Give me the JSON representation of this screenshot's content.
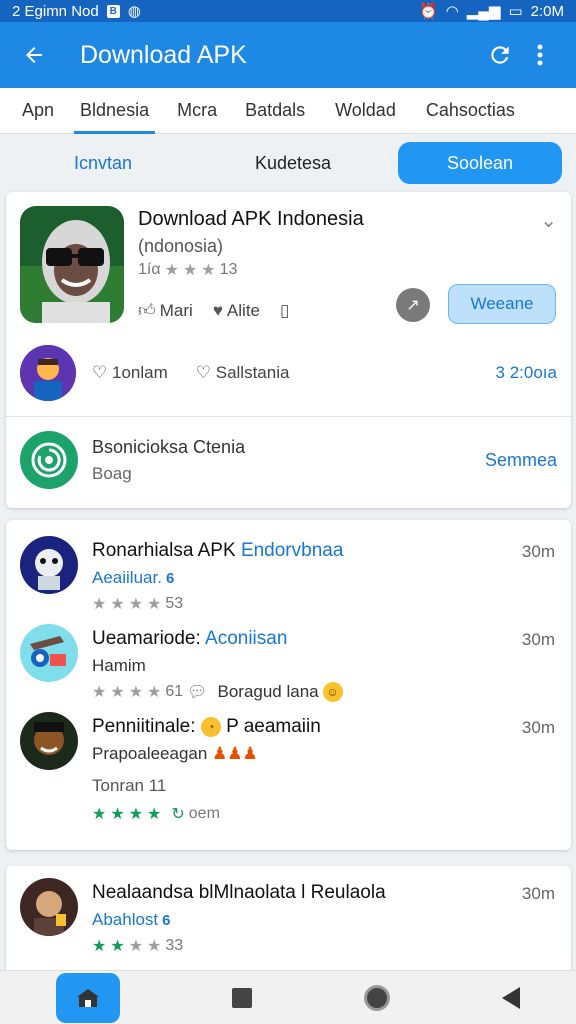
{
  "status_bar": {
    "time_left": "2 Egimn Nod",
    "time_right": "2:0M"
  },
  "appbar": {
    "title": "Download APK"
  },
  "tabs": [
    {
      "label": "Apn"
    },
    {
      "label": "Bldnesia"
    },
    {
      "label": "Mcra"
    },
    {
      "label": "Batdals"
    },
    {
      "label": "Woldad"
    },
    {
      "label": "Cahsoctias"
    }
  ],
  "segments": {
    "left": "Icnvtan",
    "center": "Kudetesa",
    "right": "Soolean"
  },
  "app_card": {
    "title": "Download APK Indonesia",
    "subtitle": "(ndonosia)",
    "rating_prefix": "1íα",
    "rating_suffix": "13",
    "actions": {
      "a1": "Mari",
      "a2": "Alite"
    },
    "primary_button": "Weeane",
    "row2": {
      "m1": "1onlam",
      "m2": "Sallstania",
      "right": "3 2:0oıa"
    },
    "row3": {
      "title": "Bsonicioksa Ctenia",
      "sub": "Boag",
      "right": "Semmea"
    }
  },
  "reviews": [
    {
      "name": "Ronarhialsa APK",
      "name_accent": "Endorvbnaa",
      "time": "30m",
      "line2": "Aeaiiluar.",
      "rating_count": "53"
    },
    {
      "name": "Ueamariode:",
      "name_accent": "Aconiisan",
      "time": "30m",
      "line2": "Hamim",
      "rating_count": "61",
      "extra": "Boragud lana"
    },
    {
      "name": "Penniitinale:",
      "name_tail": "P aeamaiin",
      "time": "30m",
      "line2": "Prapoaleeagan",
      "line3": "Tonran 11",
      "rating_text": "oem"
    }
  ],
  "bottom_review": {
    "name": "Nealaandsa blMlnaolata l Reulaola",
    "time": "30m",
    "line2": "Abahlost",
    "rating_count": "33"
  },
  "colors": {
    "primary": "#1e88e5",
    "accent": "#1976d2",
    "green": "#0f9d58"
  }
}
